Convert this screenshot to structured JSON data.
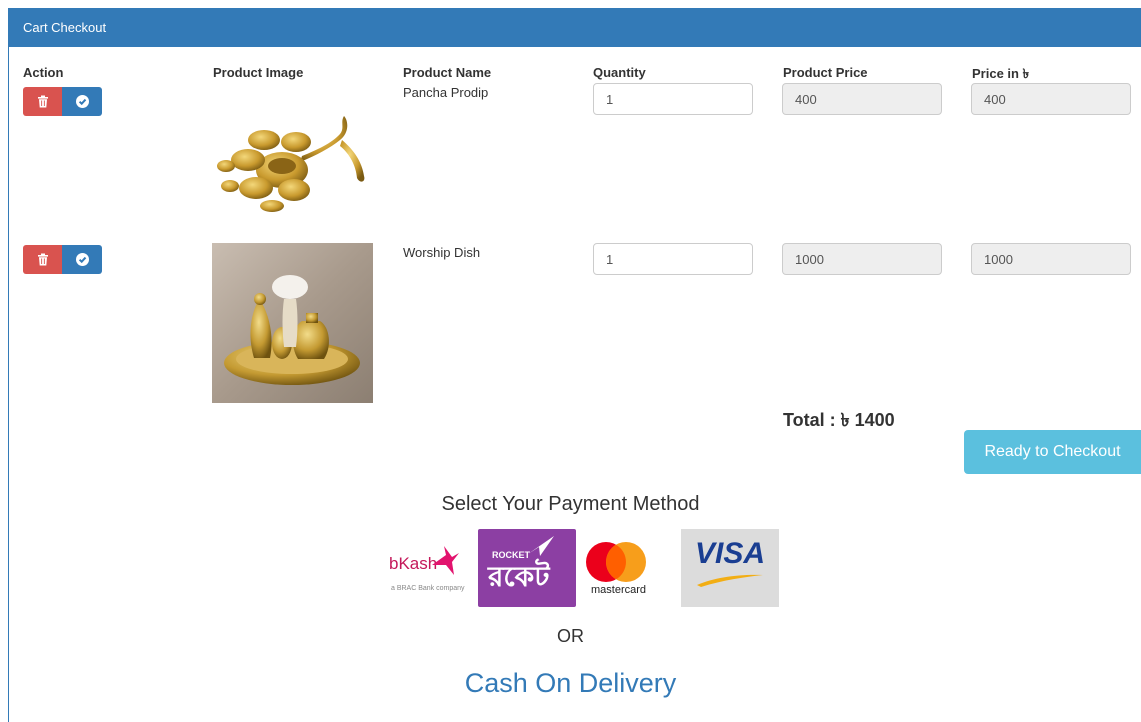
{
  "panel": {
    "title": "Cart Checkout"
  },
  "columns": {
    "action": "Action",
    "image": "Product Image",
    "name": "Product Name",
    "quantity": "Quantity",
    "price": "Product Price",
    "total_price": "Price in ৳"
  },
  "items": [
    {
      "name": "Pancha Prodip",
      "quantity": "1",
      "price": "400",
      "total": "400",
      "image_icon": "brass-lamp-image"
    },
    {
      "name": "Worship Dish",
      "quantity": "1",
      "price": "1000",
      "total": "1000",
      "image_icon": "brass-dish-image"
    }
  ],
  "summary": {
    "total_label": "Total : ৳ 1400"
  },
  "checkout_button": "Ready to Checkout",
  "payment": {
    "title": "Select Your Payment Method",
    "methods": [
      {
        "name": "bkash",
        "label": "bKash",
        "sub": "a BRAC Bank company"
      },
      {
        "name": "rocket",
        "label": "ROCKET",
        "sub": "রকেট"
      },
      {
        "name": "mastercard",
        "label": "mastercard"
      },
      {
        "name": "visa",
        "label": "VISA"
      }
    ],
    "or_text": "OR",
    "cod": "Cash On Delivery"
  },
  "colors": {
    "primary": "#337ab7",
    "danger": "#d9534f",
    "info": "#5bc0de",
    "readonly": "#eeeeee"
  }
}
